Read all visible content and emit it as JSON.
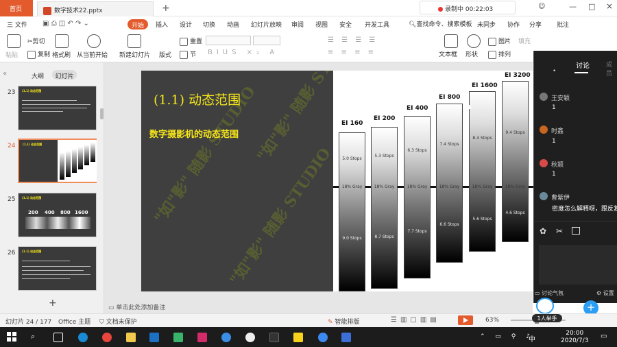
{
  "titlebar": {
    "home_tab": "首页",
    "doc_tab": "数字技术22.pptx",
    "add_tab": "+",
    "recording": "录制中 00:22:03",
    "window_controls": [
      "—",
      "□",
      "×"
    ]
  },
  "menu": {
    "file": "三 文件",
    "items": [
      "开始",
      "插入",
      "设计",
      "切换",
      "动画",
      "幻灯片放映",
      "审阅",
      "视图",
      "安全",
      "开发工具"
    ],
    "active": "开始",
    "search": "查找命令、搜索模板",
    "sync": "未同步",
    "collab": "协作",
    "share": "分享",
    "comment": "批注"
  },
  "ribbon": {
    "paste": "粘贴",
    "cut": "剪切",
    "copy": "复制",
    "format_painter": "格式刷",
    "from_current": "从当前开始",
    "new_slide": "新建幻灯片",
    "layout": "版式",
    "section": "节",
    "reset": "重置",
    "textbox": "文本框",
    "shape": "形状",
    "arrange": "排列",
    "picture": "图片",
    "fill": "填充"
  },
  "left_pane": {
    "outline": "大纲",
    "slides": "幻灯片",
    "thumbnails": [
      {
        "num": "23",
        "title": "(1.1) 动态范围"
      },
      {
        "num": "24",
        "title": "(1.1) 动态范围"
      },
      {
        "num": "25",
        "title": "(1.1) 动态范围",
        "labels": [
          "200",
          "400",
          "800",
          "1600"
        ]
      },
      {
        "num": "26",
        "title": "(1.1) 动态范围"
      }
    ],
    "add": "+"
  },
  "slide": {
    "title": "(1.1) 动态范围",
    "subtitle": "数字摄影机的动态范围",
    "watermark": "\"如\"影\" 随影 STUDIO",
    "columns": [
      {
        "label": "EI 160",
        "top": "5.0 Stops",
        "mid": "18% Gray",
        "bottom": "9.0 Stops"
      },
      {
        "label": "EI 200",
        "top": "5.3 Stops",
        "mid": "18% Gray",
        "bottom": "8.7 Stops"
      },
      {
        "label": "EI 400",
        "top": "6.3 Stops",
        "mid": "18% Gray",
        "bottom": "7.7 Stops"
      },
      {
        "label": "EI 800",
        "top": "7.4 Stops",
        "mid": "18% Gray",
        "bottom": "6.6 Stops"
      },
      {
        "label": "EI 1600",
        "top": "8.4 Stops",
        "mid": "18% Gray",
        "bottom": "5.6 Stops"
      },
      {
        "label": "EI 3200",
        "top": "9.4 Stops",
        "mid": "18% Gray",
        "bottom": "4.6 Stops"
      }
    ]
  },
  "notes": "单击此处添加备注",
  "statusbar": {
    "slide_count": "幻灯片 24 / 177",
    "theme": "Office 主题",
    "protect": "文档未保护",
    "smart": "智能排版",
    "zoom": "63%",
    "raise_hand": "1人举手"
  },
  "panel": {
    "tab_discuss": "讨论",
    "tab_other": "成员",
    "comments": [
      {
        "user": "王安颖",
        "text": "1",
        "color": "#777"
      },
      {
        "user": "时鑫",
        "text": "1",
        "color": "#c8661f"
      },
      {
        "user": "秋颖",
        "text": "1",
        "color": "#d84a4a"
      },
      {
        "user": "曹紫伊",
        "text": "密度怎么解释呀，跟反复",
        "color": "#6a8a9a"
      }
    ],
    "atmosphere": "讨论气氛",
    "settings": "设置"
  },
  "taskbar": {
    "ime": "中",
    "time": "20:00",
    "date": "2020/7/3"
  }
}
